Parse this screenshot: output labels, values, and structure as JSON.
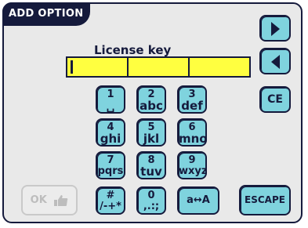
{
  "header": {
    "title": "ADD OPTION"
  },
  "license": {
    "label": "License key"
  },
  "keypad": {
    "k1": {
      "digit": "1",
      "letters": "␣"
    },
    "k2": {
      "digit": "2",
      "letters": "abc"
    },
    "k3": {
      "digit": "3",
      "letters": "def"
    },
    "k4": {
      "digit": "4",
      "letters": "ghi"
    },
    "k5": {
      "digit": "5",
      "letters": "jkl"
    },
    "k6": {
      "digit": "6",
      "letters": "mno"
    },
    "k7": {
      "digit": "7",
      "letters": "pqrs"
    },
    "k8": {
      "digit": "8",
      "letters": "tuv"
    },
    "k9": {
      "digit": "9",
      "letters": "wxyz"
    },
    "khash": {
      "digit": "#",
      "letters": "/-+*"
    },
    "k0": {
      "digit": "0",
      "letters": ",.:;"
    },
    "case": "a↔A"
  },
  "buttons": {
    "ce": "CE",
    "escape": "ESCAPE",
    "ok": "OK"
  },
  "icons": {
    "next": "right-arrow-icon",
    "prev": "left-arrow-icon",
    "ok": "thumbs-up-icon"
  },
  "colors": {
    "key": "#7fd3de",
    "field": "#ffff40",
    "frame": "#151a3c"
  }
}
